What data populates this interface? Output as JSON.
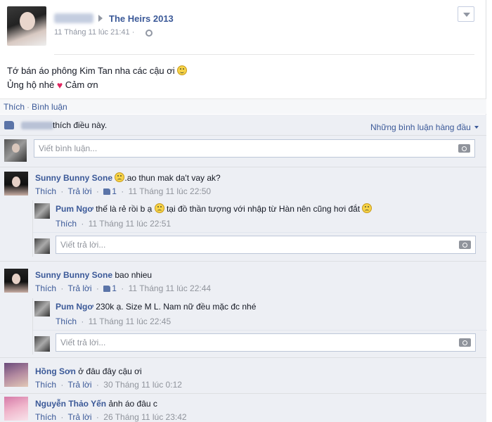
{
  "post": {
    "group": "The Heirs 2013",
    "timestamp": "11 Tháng 11 lúc 21:41 ·",
    "text_line1": "Tớ bán áo phông Kim Tan nha các cậu ơi",
    "text_line2_a": "Ủng hộ nhé",
    "text_line2_b": "Cảm ơn"
  },
  "actions": {
    "like": "Thích",
    "comment": "Bình luận"
  },
  "likes": {
    "text": "thích điều này.",
    "sort": "Những bình luận hàng đầu"
  },
  "comment_input": {
    "placeholder": "Viết bình luận..."
  },
  "reply_input": {
    "placeholder": "Viết trả lời..."
  },
  "comments": [
    {
      "name": "Sunny Bunny Sone",
      "text": ".ao thun mak da't vay ak?",
      "like": "Thích",
      "reply": "Trả lời",
      "likes_count": "1",
      "time": "11 Tháng 11 lúc 22:50",
      "replies": [
        {
          "name": "Pum Ngơ",
          "text_a": "thế là rẻ rồi b ạ",
          "text_b": "tại đồ thần tượng với nhập từ Hàn nên cũng hơi đắt",
          "like": "Thích",
          "time": "11 Tháng 11 lúc 22:51"
        }
      ]
    },
    {
      "name": "Sunny Bunny Sone",
      "text": "bao nhieu",
      "like": "Thích",
      "reply": "Trả lời",
      "likes_count": "1",
      "time": "11 Tháng 11 lúc 22:44",
      "replies": [
        {
          "name": "Pum Ngơ",
          "text_a": "230k ạ. Size M L. Nam nữ đều mặc đc nhé",
          "like": "Thích",
          "time": "11 Tháng 11 lúc 22:45"
        }
      ]
    },
    {
      "name": "Hồng Sơn",
      "text": "ở đâu đây cậu ơi",
      "like": "Thích",
      "reply": "Trả lời",
      "time": "30 Tháng 11 lúc 0:12"
    },
    {
      "name": "Nguyễn Thảo Yến",
      "text": "ảnh áo đâu c",
      "like": "Thích",
      "reply": "Trả lời",
      "time": "26 Tháng 11 lúc 23:42"
    }
  ],
  "separator": "·"
}
